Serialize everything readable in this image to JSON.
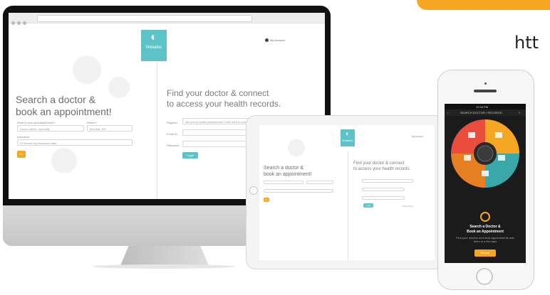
{
  "header": {
    "url_fragment": "htt"
  },
  "desktop": {
    "logo_text": "findadoc",
    "top_right_link": "My Account",
    "left_heading_line1": "Search a doctor &",
    "left_heading_line2": "book an appointment!",
    "label_specialty": "What is your specialty/Doctor?",
    "label_where": "Where?",
    "input_specialty_placeholder": "Doctor name / specialty",
    "input_where_value": "Mumbai, MH",
    "label_insurance": "Insurance",
    "select_insurance_value": "I'll choose my insurance later",
    "search_button": "Go",
    "right_heading_line1": "Find your doctor & connect",
    "right_heading_line2": "to access your health records.",
    "label_patient": "Register",
    "input_patient_value": "Are you a health professional? Click here to know more",
    "label_email": "Email ID",
    "label_password": "Password",
    "login_button": "Login"
  },
  "tablet": {
    "logo_text": "findadoc",
    "top_right_link": "My Account",
    "left_heading_line1": "Search a doctor &",
    "left_heading_line2": "book an appointment!",
    "right_heading_line1": "Find your doctor & connect",
    "right_heading_line2": "to access your health records.",
    "search_button": "Go",
    "login_button": "Login",
    "forgot_link": "Forgot pass"
  },
  "phone": {
    "status_time": "12:34 PM",
    "app_title": "SEARCH DOCTOR / RECORDS",
    "cta_title_line1": "Search a Doctor &",
    "cta_title_line2": "Book an Appointment",
    "cta_sub_line1": "Find your doctors and book appointments with",
    "cta_sub_line2": "them in a few taps",
    "cta_button": "Search",
    "wheel_colors": [
      "#e94e3c",
      "#f5a623",
      "#3aa7a9",
      "#e67e22"
    ]
  },
  "colors": {
    "accent_orange": "#f5a623",
    "brand_teal": "#5ec3c7"
  }
}
